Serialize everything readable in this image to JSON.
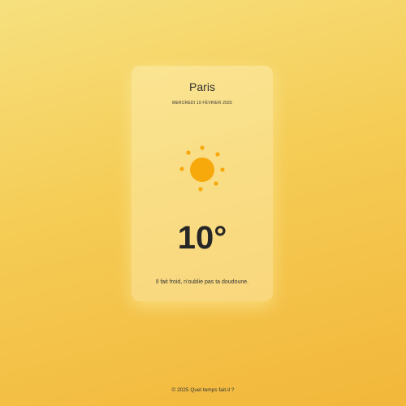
{
  "weather": {
    "city": "Paris",
    "date": "MERCREDI 19 FÉVRIER 2025",
    "icon": "sun-icon",
    "temperature": "10°",
    "message": "Il fait froid, n'oublie pas ta doudoune."
  },
  "footer": {
    "text": "© 2025 Quel temps fait-il ?"
  },
  "colors": {
    "background_top": "#f6e07e",
    "background_bottom": "#f2b73a",
    "sun": "#f7a90c",
    "text": "#2b2b2b"
  }
}
